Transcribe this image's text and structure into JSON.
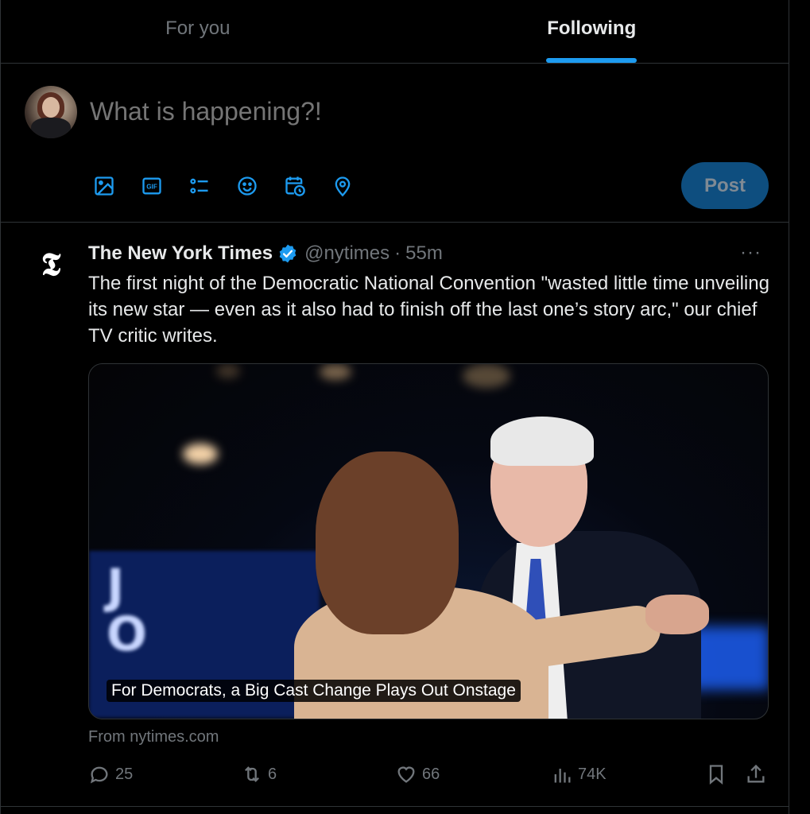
{
  "tabs": [
    {
      "label": "For you",
      "active": false
    },
    {
      "label": "Following",
      "active": true
    }
  ],
  "composer": {
    "placeholder": "What is happening?!",
    "post_label": "Post",
    "tools": [
      "image-icon",
      "gif-icon",
      "poll-icon",
      "emoji-icon",
      "schedule-icon",
      "location-icon"
    ]
  },
  "tweet": {
    "author_name": "The New York Times",
    "handle": "@nytimes",
    "separator": "·",
    "time": "55m",
    "more_label": "···",
    "text": "The first night of the Democratic National Convention \"wasted little time unveiling its new star — even as it also had to finish off the last one’s story arc,\" our chief TV critic writes.",
    "media_caption": "For Democrats, a Big Cast Change Plays Out Onstage",
    "source": "From nytimes.com",
    "logo_glyph": "𝕿",
    "stats": {
      "replies": "25",
      "reposts": "6",
      "likes": "66",
      "views": "74K"
    }
  },
  "colors": {
    "accent": "#1d9bf0",
    "background": "#000000",
    "muted": "#71767b",
    "text": "#e7e9ea",
    "border": "#2f3336"
  }
}
